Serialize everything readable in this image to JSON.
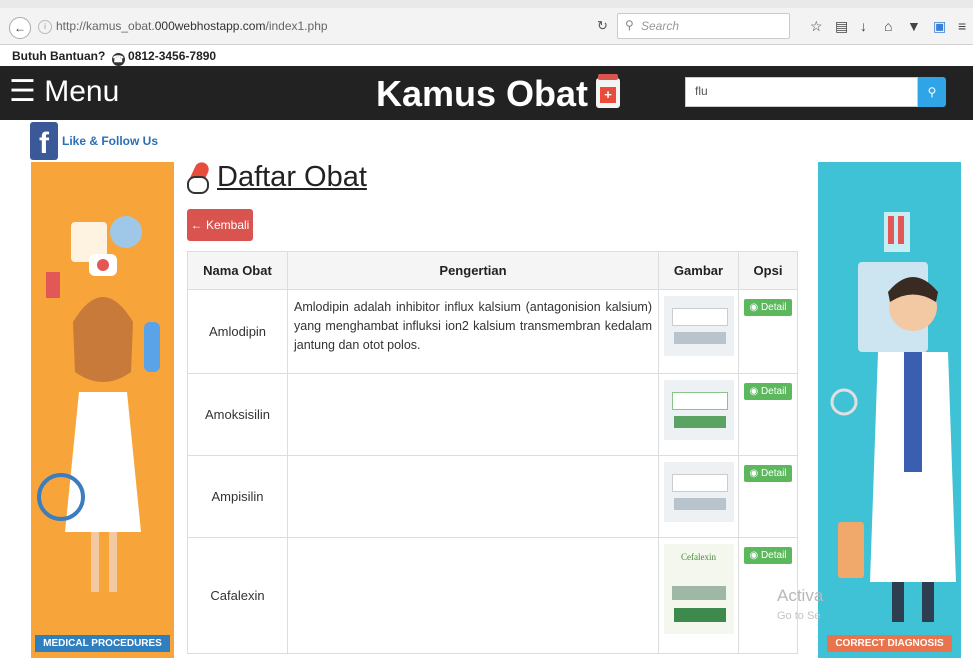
{
  "browser": {
    "url_prefix": "http://kamus_obat.",
    "url_host": "000webhostapp.com",
    "url_path": "/index1.php",
    "search_placeholder": "Search"
  },
  "help": {
    "label": "Butuh Bantuan?",
    "phone": "0812-3456-7890"
  },
  "navbar": {
    "menu_label": "☰ Menu",
    "brand": "Kamus Obat",
    "brand_icon_glyph": "+",
    "search_value": "flu",
    "search_button_icon": "search-icon"
  },
  "social": {
    "fb_glyph": "f",
    "label": "Like & Follow Us"
  },
  "banners": {
    "left_caption": "MEDICAL PROCEDURES",
    "right_caption": "CORRECT DIAGNOSIS"
  },
  "main": {
    "title": "Daftar Obat",
    "back_label": "← Kembali"
  },
  "table": {
    "headers": [
      "Nama Obat",
      "Pengertian",
      "Gambar",
      "Opsi"
    ],
    "detail_label": "◉ Detail",
    "rows": [
      {
        "name": "Amlodipin",
        "desc": "Amlodipin adalah inhibitor influx kalsium (antagonision kalsium) yang menghambat influksi ion2 kalsium transmembran kedalam jantung dan otot polos."
      },
      {
        "name": "Amoksisilin",
        "desc": ""
      },
      {
        "name": "Ampisilin",
        "desc": ""
      },
      {
        "name": "Cafalexin",
        "desc": "",
        "image_label": "Cefalexin"
      }
    ]
  },
  "watermark": {
    "line1": "Activa",
    "line2": "Go to Se"
  },
  "colors": {
    "navbar": "#222222",
    "search_button": "#2fa4e7",
    "back_button": "#d9534f",
    "detail_button": "#5cb85c",
    "facebook": "#3b5998"
  }
}
